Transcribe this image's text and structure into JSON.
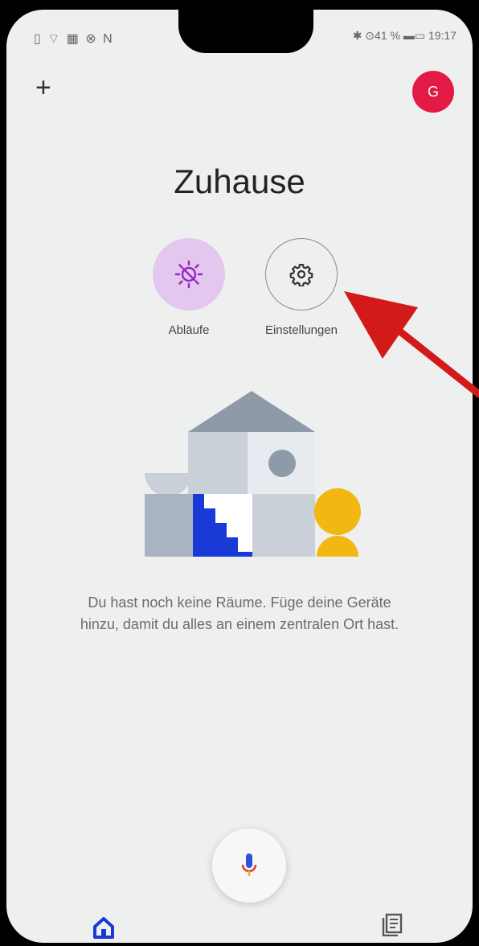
{
  "status_bar": {
    "left_icons": "▯ ⌔ ▦ ⊗ N",
    "right": "✱ ⊙41 % ▬▭ 19:17"
  },
  "header": {
    "add_icon": "plus-icon",
    "add_label": "+",
    "avatar_initial": "G",
    "avatar_color": "#e31b44"
  },
  "title": "Zuhause",
  "actions": [
    {
      "label": "Abläufe",
      "icon": "routine-icon"
    },
    {
      "label": "Einstellungen",
      "icon": "gear-icon"
    }
  ],
  "empty_state": {
    "text": "Du hast noch keine Räume. Füge deine Geräte hinzu, damit du alles an einem zentralen Ort hast."
  },
  "bottom_nav": [
    {
      "icon": "home-icon",
      "active": true
    },
    {
      "icon": "mic-icon"
    },
    {
      "icon": "feed-icon"
    }
  ],
  "colors": {
    "accent": "#1a3ad8",
    "annotation_arrow": "#d31a1a",
    "routine_bg": "#e3c7ef"
  }
}
